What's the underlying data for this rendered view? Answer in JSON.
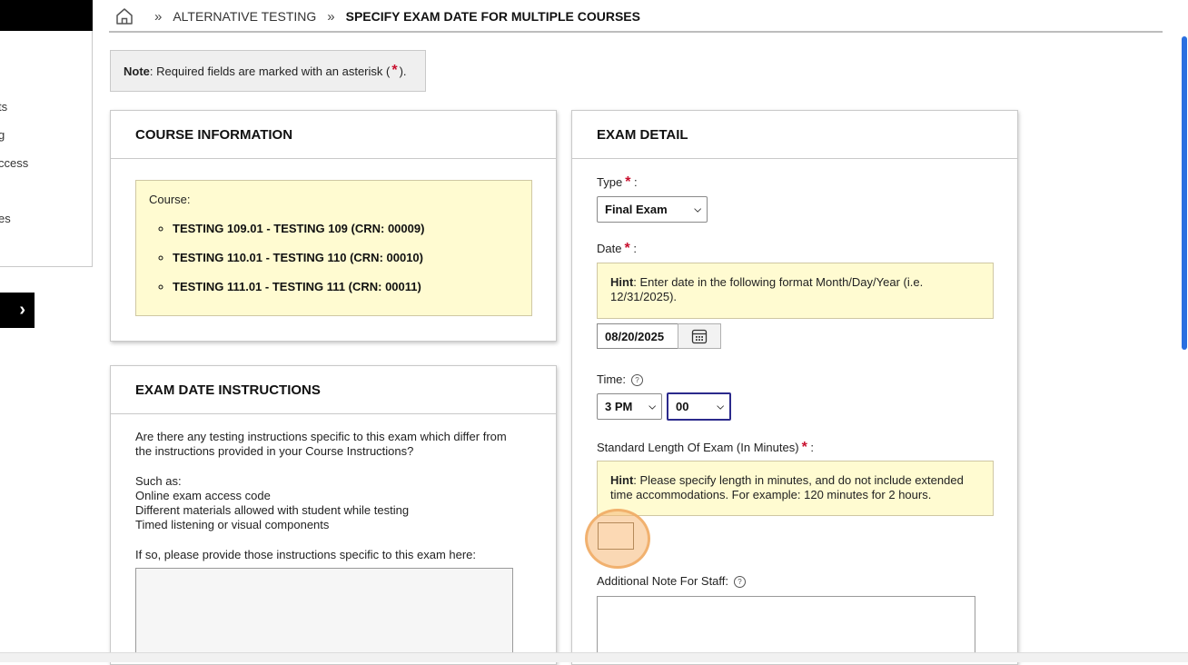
{
  "sidebar": {
    "items": [
      "ts",
      "g",
      "ccess",
      "es"
    ],
    "next_icon": "chevron-right-icon"
  },
  "breadcrumb": {
    "home_icon": "home-icon",
    "separator": "»",
    "items": [
      "ALTERNATIVE TESTING",
      "SPECIFY EXAM DATE FOR MULTIPLE COURSES"
    ]
  },
  "note": {
    "label": "Note",
    "text": ": Required fields are marked with an asterisk (",
    "asterisk": "*",
    "suffix": ")."
  },
  "course_info": {
    "title": "COURSE INFORMATION",
    "course_label": "Course:",
    "courses": [
      "TESTING 109.01 - TESTING 109 (CRN: 00009)",
      "TESTING 110.01 - TESTING 110 (CRN: 00010)",
      "TESTING 111.01 - TESTING 111 (CRN: 00011)"
    ]
  },
  "exam_instructions": {
    "title": "EXAM DATE INSTRUCTIONS",
    "question_line1": "Are there any testing instructions specific to this exam which differ from",
    "question_line2": "the instructions provided in your Course Instructions?",
    "such_as": "Such as:",
    "examples": [
      "Online exam access code",
      "Different materials allowed with student while testing",
      "Timed listening or visual components"
    ],
    "prompt": "If so, please provide those instructions specific to this exam here:"
  },
  "exam_detail": {
    "title": "EXAM DETAIL",
    "type_label": "Type",
    "type_value": "Final Exam",
    "date_label": "Date",
    "date_hint_bold": "Hint",
    "date_hint_line1": ": Enter date in the following format Month/Day/Year (i.e.",
    "date_hint_line2": "12/31/2025).",
    "date_value": "08/20/2025",
    "calendar_icon": "calendar-icon",
    "time_label": "Time:",
    "time_hour": "3 PM",
    "time_minute": "00",
    "length_label": "Standard Length Of Exam (In Minutes)",
    "length_hint_bold": "Hint",
    "length_hint_line1": ": Please specify length in minutes, and do not include extended",
    "length_hint_line2": "time accommodations. For example: 120 minutes for 2 hours.",
    "length_value": "",
    "note_label": "Additional Note For Staff:",
    "help_icon": "help-circle-icon"
  },
  "colors": {
    "required_star": "#c8102e",
    "hint_bg": "#fffbd1",
    "focus_border": "#2b2a8c",
    "click_highlight": "#f5b877",
    "scroll_thumb": "#2a6fe0"
  }
}
